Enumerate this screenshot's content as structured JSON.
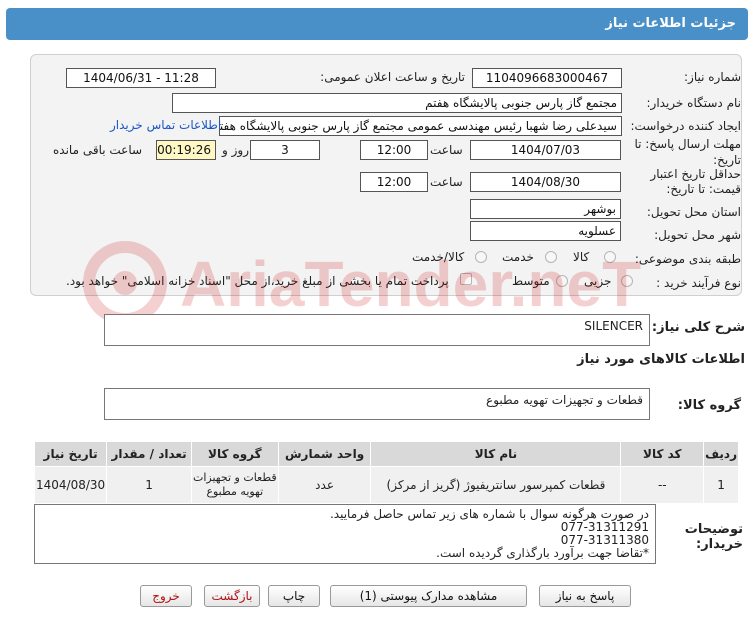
{
  "page": {
    "title": "جزئیات اطلاعات نیاز"
  },
  "fields": {
    "need_number_label": "شماره نیاز:",
    "need_number": "1104096683000467",
    "announce_label": "تاریخ و ساعت اعلان عمومی:",
    "announce_value": "1404/06/31 - 11:28",
    "buyer_org_label": "نام دستگاه خریدار:",
    "buyer_org": "مجتمع گاز پارس جنوبی  پالایشگاه هفتم",
    "requester_label": "ایجاد کننده درخواست:",
    "requester": "سیدعلی رضا شهبا رئیس مهندسی عمومی مجتمع گاز پارس جنوبی  پالایشگاه هفتم",
    "buyer_contact_link": "اطلاعات تماس خریدار",
    "reply_deadline_label": "مهلت ارسال پاسخ: تا تاریخ:",
    "reply_date": "1404/07/03",
    "time_label": "ساعت",
    "reply_time": "12:00",
    "days_value": "3",
    "days_label": "روز و",
    "remaining_time": "00:19:26",
    "remaining_label": "ساعت باقی مانده",
    "validity_label_1": "حداقل تاریخ اعتبار",
    "validity_label_2": "قیمت: تا تاریخ:",
    "validity_date": "1404/08/30",
    "validity_time": "12:00",
    "province_label": "استان محل تحویل:",
    "province": "بوشهر",
    "city_label": "شهر محل تحویل:",
    "city": "عسلویه",
    "category_label": "طبقه بندی موضوعی:",
    "category_options": [
      "کالا",
      "خدمت",
      "کالا/خدمت"
    ],
    "process_label": "نوع فرآیند خرید :",
    "process_options": [
      "جزیی",
      "متوسط"
    ],
    "payment_note": "پرداخت تمام یا بخشی از مبلغ خرید،از محل \"اسناد خزانه اسلامی\" خواهد بود."
  },
  "summary": {
    "label": "شرح کلی نیاز:",
    "value": "SILENCER"
  },
  "goods_info_heading": "اطلاعات کالاهای مورد نیاز",
  "goods_group": {
    "label": "گروه کالا:",
    "value": "قطعات و تجهیزات تهویه مطبوع"
  },
  "table": {
    "headers": [
      "ردیف",
      "کد کالا",
      "نام کالا",
      "واحد شمارش",
      "گروه کالا",
      "تعداد / مقدار",
      "تاریخ نیاز"
    ],
    "rows": [
      [
        "1",
        "--",
        "قطعات کمپرسور سانتریفیوژ (گریز از مرکز)",
        "عدد",
        "قطعات و تجهیزات تهویه مطبوع",
        "1",
        "1404/08/30"
      ]
    ]
  },
  "buyer_notes": {
    "label": "توضیحات خریدار:",
    "lines": [
      "در صورت هرگونه سوال با شماره های زیر تماس حاصل فرمایید.",
      "077-31311291",
      "077-31311380",
      "*تقاضا جهت برآورد بارگذاری گردیده است."
    ]
  },
  "buttons": {
    "reply": "پاسخ به نیاز",
    "attachments": "مشاهده مدارک پیوستی (1)",
    "print": "چاپ",
    "back": "بازگشت",
    "exit": "خروج"
  },
  "watermark": "AriaTender.neT",
  "colors": {
    "title_bar": "#4a90c8",
    "remaining_highlight": "#fff7c4",
    "link": "#1a56c4"
  }
}
